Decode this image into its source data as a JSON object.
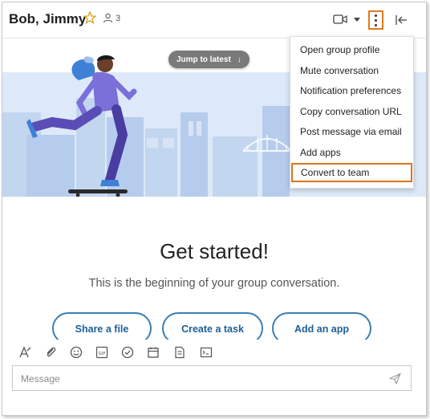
{
  "header": {
    "title": "Bob, Jimmy",
    "member_count": "3",
    "icons": [
      "star-icon",
      "people-icon",
      "video-icon",
      "chevron-down-icon",
      "more-vertical-icon",
      "collapse-panel-icon"
    ]
  },
  "banner": {
    "jump_label": "Jump to latest",
    "jump_icon": "arrow-down-icon"
  },
  "menu": {
    "items": [
      {
        "label": "Open group profile"
      },
      {
        "label": "Mute conversation"
      },
      {
        "label": "Notification preferences"
      },
      {
        "label": "Copy conversation URL"
      },
      {
        "label": "Post message via email"
      },
      {
        "label": "Add apps"
      },
      {
        "label": "Convert to team"
      }
    ],
    "highlighted": "Convert to team"
  },
  "main": {
    "heading": "Get started!",
    "subtitle": "This is the beginning of your group conversation.",
    "actions": [
      {
        "label": "Share a file"
      },
      {
        "label": "Create a task"
      },
      {
        "label": "Add an app"
      }
    ]
  },
  "composer": {
    "placeholder": "Message",
    "tools": [
      "format-icon",
      "attach-icon",
      "emoji-icon",
      "gif-icon",
      "task-icon",
      "calendar-icon",
      "note-icon",
      "code-icon"
    ]
  },
  "colors": {
    "highlight": "#e07b1b",
    "accent": "#1d5f97",
    "banner_sky": "#dde9f8",
    "banner_buildings": "#c3d6f0"
  }
}
